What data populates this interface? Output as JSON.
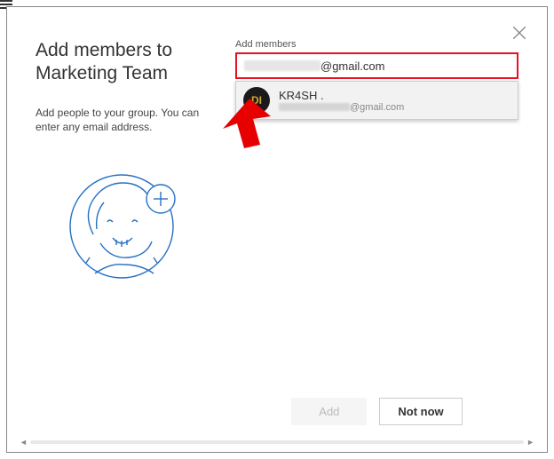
{
  "dialog": {
    "heading": "Add members to Marketing Team",
    "description": "Add people to your group. You can enter any email address.",
    "field_label": "Add members",
    "input_value": "@gmail.com",
    "suggestion": {
      "name": "KR4SH .",
      "email_suffix": "@gmail.com",
      "avatar_initials": "DI"
    },
    "buttons": {
      "add": "Add",
      "not_now": "Not now"
    }
  },
  "annotation": {
    "input_border_color": "#e81123",
    "arrow_color": "#e60000"
  }
}
